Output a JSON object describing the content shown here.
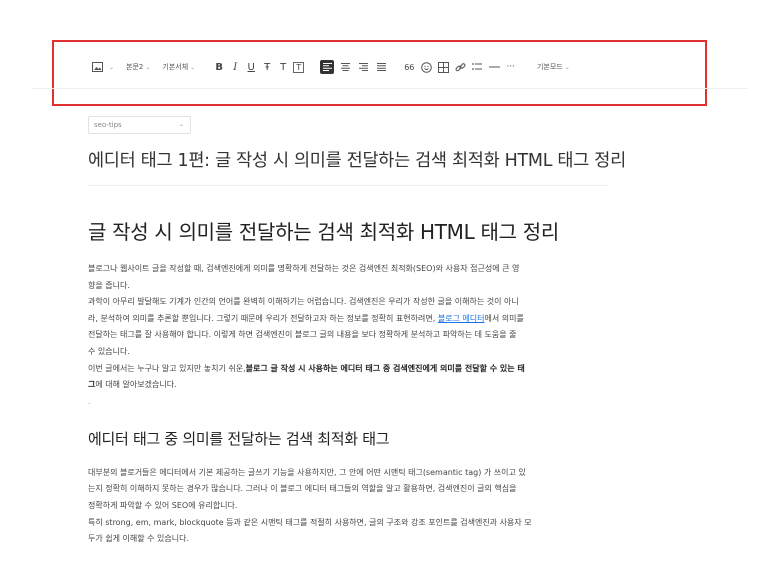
{
  "toolbar": {
    "paragraph_style": "본문2",
    "font_family": "기본서체",
    "view_mode": "기본모드",
    "quote_label": "66",
    "more_label": "···",
    "icons": [
      "image-icon",
      "bold-icon",
      "italic-icon",
      "underline-icon",
      "strikethrough-icon",
      "text-color-icon",
      "text-background-icon",
      "align-left-icon",
      "align-center-icon",
      "align-right-icon",
      "align-justify-icon",
      "quote-icon",
      "emoji-icon",
      "table-icon",
      "link-icon",
      "list-icon",
      "divider-icon",
      "more-icon"
    ],
    "buttons": {
      "bold": "B",
      "italic": "I",
      "underline": "U",
      "strike": "Ŧ",
      "text_color": "T",
      "text_bg": "T"
    }
  },
  "editor": {
    "category": "seo-tips",
    "title": "에디터 태그 1편: 글 작성 시 의미를 전달하는 검색 최적화  HTML 태그 정리",
    "heading1": "글 작성 시 의미를 전달하는 검색 최적화 HTML 태그 정리",
    "intro": {
      "l1": "블로그나 웹사이트 글을 작성할 때, 검색엔진에게 의미를 명확하게 전달하는 것은 검색엔진 최적화(SEO)와 사용자 접근성에 큰 영",
      "l2": "향을 줍니다.",
      "l3": "과학이 아무리 발달해도 기계가 인간의 언어를 완벽히 이해하기는 어렵습니다. 검색엔진은 우리가 작성한 글을 이해하는 것이 아니",
      "l4_pre": "라, 분석하여 의미를 추론할 뿐입니다. 그렇기 때문에 우리가 전달하고자 하는 정보를 정확히 표현하려면, ",
      "l4_link": "블로그 에디터",
      "l4_post": "에서 의미를",
      "l5": "전달하는 태그를 잘 사용해야 합니다. 이렇게 하면 검색엔진이 블로그 글의 내용을 보다 정확하게 분석하고 파악하는 데 도움을 줄",
      "l6": "수 있습니다.",
      "l7_pre": "이번 글에서는 누구나 알고 있지만 놓치기 쉬운,",
      "l7_bold": "블로그 글 작성 시 사용하는 에디터 태그 중 검색엔진에게 의미를 전달할 수 있는 태",
      "l8_bold": "그",
      "l8_post": "에 대해 알아보겠습니다.",
      "dot": "."
    },
    "heading2": "에디터 태그 중 의미를 전달하는 검색 최적화 태그",
    "body2": {
      "l1": "대부분의 블로거들은 에디터에서 기본 제공하는 글쓰기 기능을 사용하지만, 그 안에 어떤 시맨틱 태그(semantic tag) 가 쓰이고 있",
      "l2": "는지 정확히 이해하지 못하는 경우가 많습니다. 그러나 이 블로그 에디터 태그들의 역할을 알고 활용하면, 검색엔진이 글의 핵심을",
      "l3": "정확하게 파악할 수 있어 SEO에 유리합니다.",
      "l4": "특히 strong, em, mark, blockquote 등과 같은 시맨틱 태그를 적절히 사용하면, 글의 구조와 강조 포인트를 검색엔진과 사용자 모",
      "l5": "두가 쉽게 이해할 수 있습니다."
    }
  },
  "colors": {
    "highlight_border": "#e03131",
    "link": "#1a73e8",
    "active_align_bg": "#333333"
  }
}
